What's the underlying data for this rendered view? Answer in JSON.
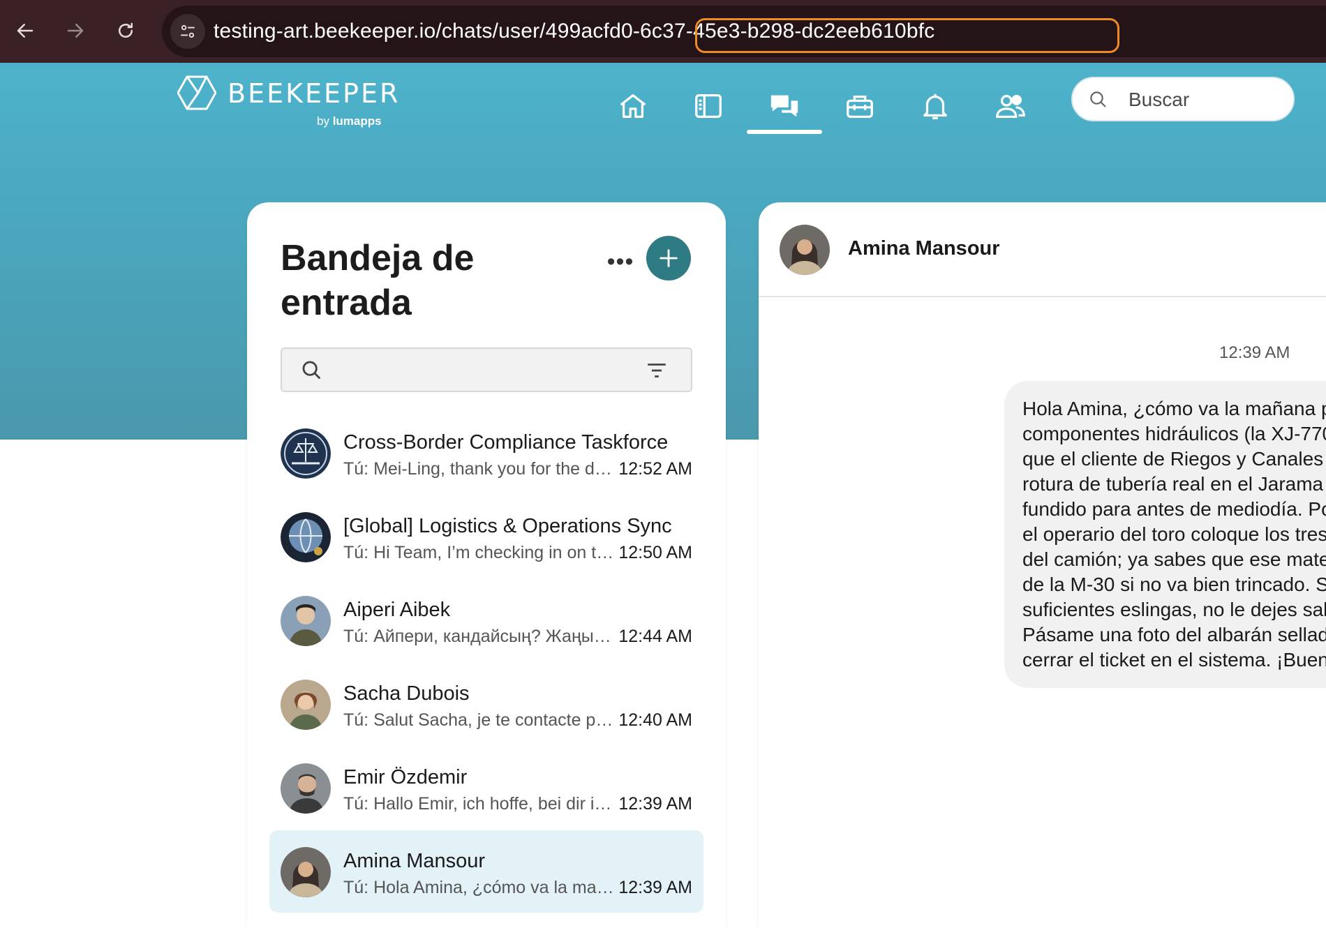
{
  "browser": {
    "url": "testing-art.beekeeper.io/chats/user/499acfd0-6c37-45e3-b298-dc2eeb610bfc"
  },
  "app": {
    "logo_word": "BEEKEEPER",
    "logo_by": "by",
    "logo_brand": "lumapps",
    "search_placeholder": "Buscar",
    "nav_items": [
      "home-icon",
      "journal-icon",
      "chats-icon",
      "toolbox-icon",
      "notifications-icon",
      "people-icon"
    ],
    "active_nav": "chats-icon",
    "accent_color": "#2f7b84"
  },
  "inbox": {
    "title": "Bandeja de entrada",
    "more_label": "•••",
    "chats": [
      {
        "name": "Cross-Border Compliance Taskforce",
        "preview": "Tú: Mei-Ling, thank you for the de...",
        "time": "12:52 AM",
        "selected": false
      },
      {
        "name": "[Global] Logistics & Operations Sync",
        "preview": "Tú: Hi Team, I’m checking in on th...",
        "time": "12:50 AM",
        "selected": false
      },
      {
        "name": "Aiperi Aibek",
        "preview": "Tú: Айпери, кандайсың? Жаңы м...",
        "time": "12:44 AM",
        "selected": false
      },
      {
        "name": "Sacha Dubois",
        "preview": "Tú: Salut Sacha, je te contacte po...",
        "time": "12:40 AM",
        "selected": false
      },
      {
        "name": "Emir Özdemir",
        "preview": "Tú: Hallo Emir, ich hoffe, bei dir in ...",
        "time": "12:39 AM",
        "selected": false
      },
      {
        "name": "Amina Mansour",
        "preview": "Tú: Hola Amina, ¿cómo va la mañ...",
        "time": "12:39 AM",
        "selected": true
      }
    ]
  },
  "conversation": {
    "name": "Amina Mansour",
    "time": "12:39 AM",
    "message_lines": [
      "Hola Amina, ¿cómo va la mañana p",
      "componentes hidráulicos (la XJ-770",
      "que el cliente de Riegos y Canales t",
      "rotura de tubería real en el Jarama",
      "fundido para antes de mediodía. Po",
      "el operario del toro coloque los tres",
      "del camión; ya sabes que ese mater",
      "de la M-30 si no va bien trincado. Si",
      "suficientes eslingas, no le dejes sali",
      "Pásame una foto del albarán sellad",
      "cerrar el ticket en el sistema. ¡Buen"
    ]
  }
}
